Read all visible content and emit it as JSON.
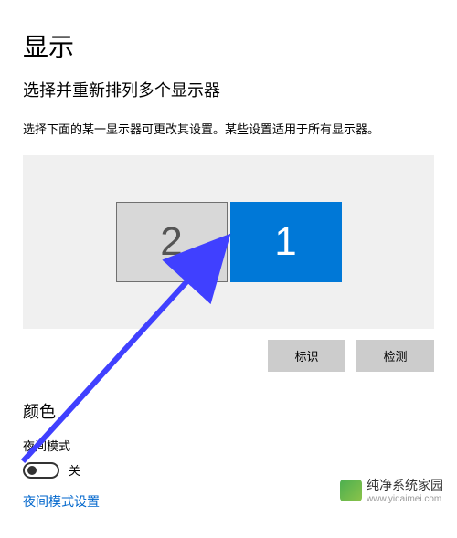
{
  "header": {
    "title": "显示",
    "subtitle": "选择并重新排列多个显示器",
    "description": "选择下面的某一显示器可更改其设置。某些设置适用于所有显示器。"
  },
  "monitors": {
    "monitor2": "2",
    "monitor1": "1"
  },
  "buttons": {
    "identify": "标识",
    "detect": "检测"
  },
  "color_section": {
    "title": "颜色",
    "night_mode_label": "夜间模式",
    "toggle_state": "关",
    "settings_link": "夜间模式设置"
  },
  "watermark": {
    "brand": "纯净系统家园",
    "url": "www.yidaimei.com"
  }
}
